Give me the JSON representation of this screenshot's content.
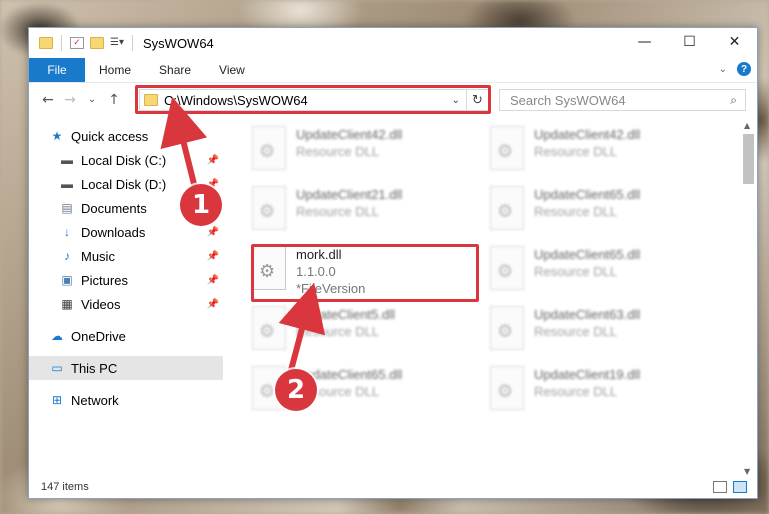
{
  "window": {
    "title": "SysWOW64",
    "controls": {
      "minimize": "—",
      "maximize": "☐",
      "close": "✕"
    }
  },
  "ribbon": {
    "file_tab": "File",
    "tabs": [
      "Home",
      "Share",
      "View"
    ],
    "help": "?"
  },
  "nav": {
    "back": "←",
    "forward": "→",
    "recent": "⌄",
    "up": "↑",
    "address": "C:\\Windows\\SysWOW64",
    "refresh": "↻",
    "search_placeholder": "Search SysWOW64"
  },
  "sidebar": {
    "items": [
      {
        "label": "Quick access",
        "icon": "star-icon"
      },
      {
        "label": "Local Disk (C:)",
        "icon": "drive-icon",
        "pinned": true
      },
      {
        "label": "Local Disk (D:)",
        "icon": "drive-icon",
        "pinned": true
      },
      {
        "label": "Documents",
        "icon": "documents-icon",
        "pinned": true
      },
      {
        "label": "Downloads",
        "icon": "download-icon",
        "pinned": true
      },
      {
        "label": "Music",
        "icon": "music-icon",
        "pinned": true
      },
      {
        "label": "Pictures",
        "icon": "pictures-icon",
        "pinned": true
      },
      {
        "label": "Videos",
        "icon": "videos-icon",
        "pinned": true
      },
      {
        "label": "OneDrive",
        "icon": "cloud-icon"
      },
      {
        "label": "This PC",
        "icon": "computer-icon",
        "selected": true
      },
      {
        "label": "Network",
        "icon": "network-icon"
      }
    ]
  },
  "files": {
    "left": [
      {
        "name": "UpdateClient42.dll",
        "sub": "Resource DLL"
      },
      {
        "name": "UpdateClient21.dll",
        "sub": "Resource DLL"
      },
      {
        "name": "mork.dll",
        "version": "1.1.0.0",
        "sub": "*FileVersion"
      },
      {
        "name": "UpdateClient5.dll",
        "sub": "Resource DLL"
      },
      {
        "name": "UpdateClient65.dll",
        "sub": "Resource DLL"
      }
    ],
    "right": [
      {
        "name": "UpdateClient42.dll",
        "sub": "Resource DLL"
      },
      {
        "name": "UpdateClient65.dll",
        "sub": "Resource DLL"
      },
      {
        "name": "UpdateClient65.dll",
        "sub": "Resource DLL"
      },
      {
        "name": "UpdateClient63.dll",
        "sub": "Resource DLL"
      },
      {
        "name": "UpdateClient19.dll",
        "sub": "Resource DLL"
      }
    ]
  },
  "status": {
    "item_count": "147 items"
  },
  "callouts": {
    "one": "1",
    "two": "2"
  },
  "colors": {
    "accent": "#1979ca",
    "highlight": "#d9363e"
  }
}
